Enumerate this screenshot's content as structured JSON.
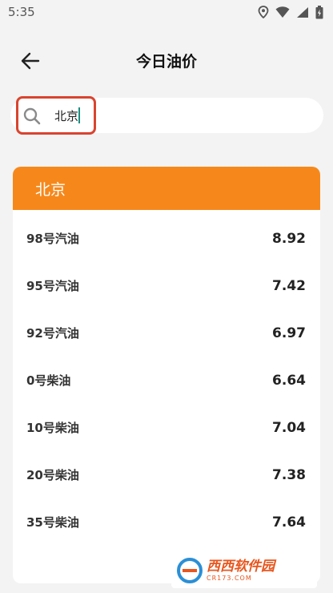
{
  "status_bar": {
    "time": "5:35"
  },
  "header": {
    "title": "今日油价"
  },
  "search": {
    "value": "北京"
  },
  "card": {
    "city": "北京",
    "prices": [
      {
        "name": "98号汽油",
        "price": "8.92"
      },
      {
        "name": "95号汽油",
        "price": "7.42"
      },
      {
        "name": "92号汽油",
        "price": "6.97"
      },
      {
        "name": "0号柴油",
        "price": "6.64"
      },
      {
        "name": "10号柴油",
        "price": "7.04"
      },
      {
        "name": "20号柴油",
        "price": "7.38"
      },
      {
        "name": "35号柴油",
        "price": "7.64"
      }
    ]
  },
  "watermark": {
    "main": "西西软件园",
    "sub": "CR173.COM"
  },
  "colors": {
    "accent": "#f6881b",
    "highlight": "#d9442f",
    "caret": "#1a8f80"
  }
}
